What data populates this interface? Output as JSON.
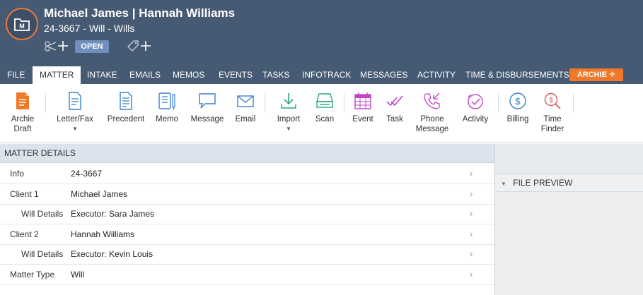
{
  "header": {
    "title": "Michael James | Hannah Williams",
    "subtitle": "24-3667 - Will - Wills",
    "status": "OPEN",
    "icons": [
      "matter-logo-icon",
      "link-add-icon",
      "tag-add-icon"
    ]
  },
  "tabs": [
    "FILE",
    "MATTER",
    "INTAKE",
    "EMAILS",
    "MEMOS",
    "EVENTS",
    "TASKS",
    "INFOTRACK",
    "MESSAGES",
    "ACTIVITY",
    "TIME & DISBURSEMENTS"
  ],
  "active_tab": "MATTER",
  "archie_button": "ARCHIE",
  "ribbon": {
    "archie_draft": "Archie\nDraft",
    "letter_fax": "Letter/Fax",
    "precedent": "Precedent",
    "memo": "Memo",
    "message": "Message",
    "email": "Email",
    "import": "Import",
    "scan": "Scan",
    "event": "Event",
    "task": "Task",
    "phone_message": "Phone\nMessage",
    "activity": "Activity",
    "billing": "Billing",
    "time_finder": "Time\nFinder"
  },
  "matter_details": {
    "heading": "MATTER DETAILS",
    "rows": [
      {
        "label": "Info",
        "value": "24-3667"
      },
      {
        "label": "Client 1",
        "value": "Michael James"
      },
      {
        "label": "Will Details",
        "value": "Executor: Sara James"
      },
      {
        "label": "Client 2",
        "value": "Hannah Williams"
      },
      {
        "label": "Will Details",
        "value": "Executor: Kevin Louis"
      },
      {
        "label": "Matter Type",
        "value": "Will"
      }
    ]
  },
  "file_preview": {
    "heading": "FILE PREVIEW"
  },
  "colors": {
    "header_bg": "#475a73",
    "accent_orange": "#f07828",
    "status_blue": "#6f8fbd"
  }
}
